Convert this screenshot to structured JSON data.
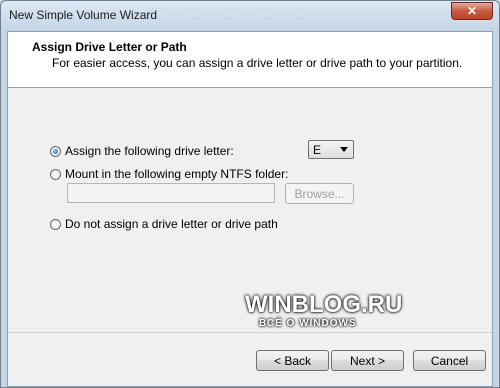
{
  "window": {
    "title": "New Simple Volume Wizard",
    "close_label": "✕"
  },
  "header": {
    "title": "Assign Drive Letter or Path",
    "subtitle": "For easier access, you can assign a drive letter or drive path to your partition."
  },
  "options": [
    {
      "label": "Assign the following drive letter:",
      "selected": true
    },
    {
      "label": "Mount in the following empty NTFS folder:",
      "selected": false
    },
    {
      "label": "Do not assign a drive letter or drive path",
      "selected": false
    }
  ],
  "drive_letter": {
    "value": "E"
  },
  "folder_path": {
    "value": ""
  },
  "buttons": {
    "browse": "Browse...",
    "back": "< Back",
    "next": "Next >",
    "cancel": "Cancel"
  },
  "watermark": {
    "main": "WINBLOG.RU",
    "sub": "ВСЁ О WINDOWS"
  }
}
